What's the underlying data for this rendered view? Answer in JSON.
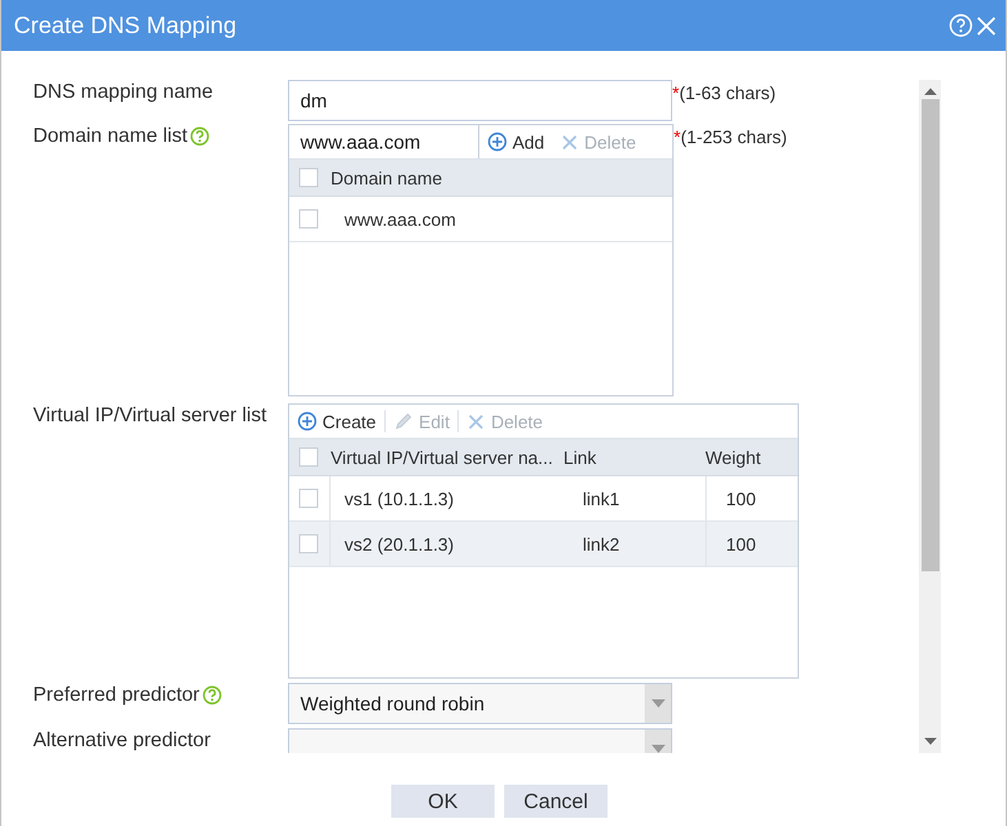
{
  "dialog": {
    "title": "Create DNS Mapping"
  },
  "form": {
    "mapping_name": {
      "label": "DNS mapping name",
      "help": false,
      "value": "dm",
      "required_mark": "*",
      "hint": "(1-63 chars)"
    },
    "domain_list": {
      "label": "Domain name list",
      "help": true,
      "input_value": "www.aaa.com",
      "required_mark": "*",
      "hint": "(1-253 chars)",
      "actions": [
        {
          "label": "Add",
          "kind": "add",
          "disabled": false
        },
        {
          "label": "Delete",
          "kind": "delete",
          "disabled": true
        }
      ],
      "header_checked": false,
      "columns": [
        "Domain name"
      ],
      "rows": [
        {
          "checked": false,
          "cells": [
            "www.aaa.com"
          ]
        }
      ]
    },
    "vs_list": {
      "label": "Virtual IP/Virtual server list",
      "help": false,
      "actions": [
        {
          "label": "Create",
          "kind": "add",
          "disabled": false
        },
        {
          "label": "Edit",
          "kind": "edit",
          "disabled": true
        },
        {
          "label": "Delete",
          "kind": "delete",
          "disabled": true
        }
      ],
      "header_checked": false,
      "columns": [
        "Virtual IP/Virtual server na...",
        "Link",
        "Weight"
      ],
      "rows": [
        {
          "checked": false,
          "cells": [
            "vs1 (10.1.1.3)",
            "link1",
            "100"
          ]
        },
        {
          "checked": false,
          "cells": [
            "vs2 (20.1.1.3)",
            "link2",
            "100"
          ]
        }
      ]
    },
    "preferred_predictor": {
      "label": "Preferred predictor",
      "help": true,
      "value": "Weighted round robin"
    },
    "alternative_predictor": {
      "label": "Alternative predictor",
      "help": false
    }
  },
  "buttons": [
    "OK",
    "Cancel"
  ]
}
